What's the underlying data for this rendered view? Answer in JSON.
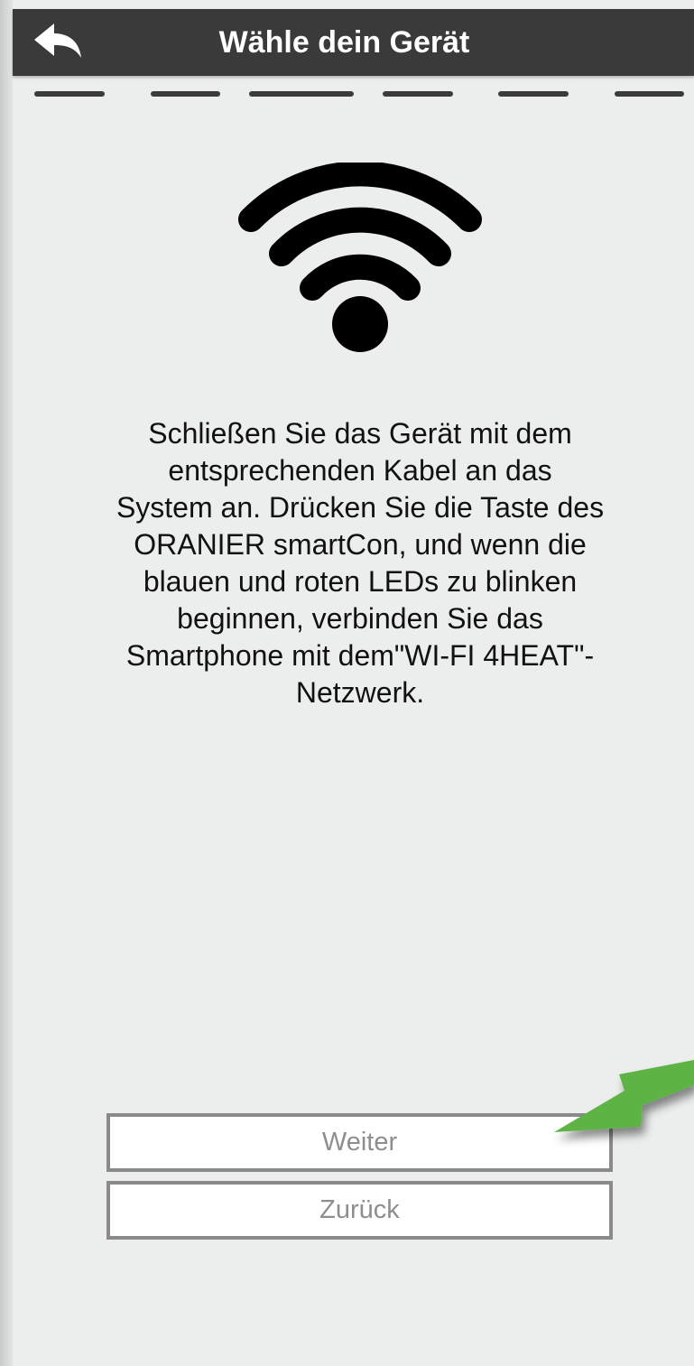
{
  "header": {
    "title": "Wähle dein Gerät",
    "back_icon": "back-arrow-icon"
  },
  "progress": {
    "total_steps": 6
  },
  "main": {
    "icon": "wifi-icon",
    "instructions": "Schließen Sie das Gerät mit dem\nentsprechenden Kabel an das\nSystem an. Drücken Sie die Taste des\nORANIER smartCon, und wenn die\nblauen und roten LEDs zu blinken\nbeginnen, verbinden Sie das\nSmartphone mit dem\"WI-FI 4HEAT\"-\nNetzwerk."
  },
  "buttons": {
    "next_label": "Weiter",
    "back_label": "Zurück"
  },
  "annotation": {
    "icon": "pointer-arrow-icon",
    "color": "#5db444"
  },
  "colors": {
    "header_bg": "#3a3a3a",
    "page_bg": "#eceeee",
    "button_border": "#8a8a8a",
    "button_text": "#8e8e8e"
  }
}
